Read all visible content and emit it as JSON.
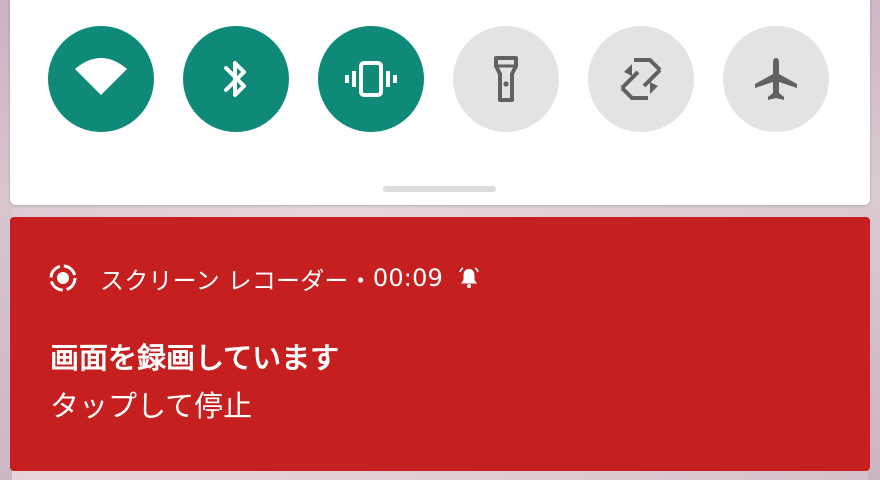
{
  "quick_settings": {
    "tiles": [
      {
        "id": "wifi",
        "icon": "wifi-icon",
        "state": "on"
      },
      {
        "id": "bluetooth",
        "icon": "bluetooth-icon",
        "state": "on"
      },
      {
        "id": "vibrate",
        "icon": "vibrate-icon",
        "state": "on"
      },
      {
        "id": "flashlight",
        "icon": "flashlight-icon",
        "state": "off"
      },
      {
        "id": "auto-rotate",
        "icon": "rotate-icon",
        "state": "off"
      },
      {
        "id": "airplane",
        "icon": "airplane-icon",
        "state": "off"
      }
    ],
    "colors": {
      "tile_on": "#0f8a78",
      "tile_off": "#e3e3e3",
      "icon_on": "#ffffff",
      "icon_off": "#616161"
    }
  },
  "notification": {
    "app_name": "スクリーン レコーダー",
    "separator": "・",
    "elapsed": "00:09",
    "title": "画面を録画しています",
    "body": "タップして停止",
    "background_color": "#c51f1f",
    "icon": "screen-record-icon",
    "alert_icon": "bell-icon"
  }
}
